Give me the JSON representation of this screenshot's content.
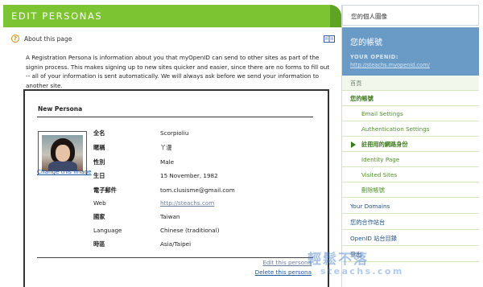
{
  "header": {
    "title": "EDIT PERSONAS"
  },
  "about": {
    "link": "About this page",
    "intro": "A Registration Persona is information about you that myOpenID can send to other sites as part of the signin process. This makes signing up to new sites quicker and easier, since there are no forms to fill out -- all of your information is sent automatically. We will always ask before we send your information to another site."
  },
  "persona": {
    "title": "New Persona",
    "change_image": "Change this image",
    "fields": [
      {
        "label": "全名",
        "value": "Scorpioliu"
      },
      {
        "label": "暱稱",
        "value": "丫漫"
      },
      {
        "label": "性別",
        "value": "Male"
      },
      {
        "label": "生日",
        "value": "15 November, 1982"
      },
      {
        "label": "電子郵件",
        "value": "tom.clusisme@gmail.com"
      },
      {
        "label": "Web",
        "value": "http://steachs.com"
      },
      {
        "label": "國家",
        "value": "Taiwan"
      },
      {
        "label": "Language",
        "value": "Chinese (traditional)"
      },
      {
        "label": "時區",
        "value": "Asia/Taipei"
      }
    ],
    "edit": "Edit this persona",
    "delete": "Delete this persona"
  },
  "sidebar": {
    "avatar_label": "您的個人圖像",
    "account_title": "您的帳號",
    "openid_label": "YOUR OPENID:",
    "openid_url": "http://steachs.myopenid.com/",
    "items": [
      {
        "label": "首頁"
      },
      {
        "label": "您的帳號"
      },
      {
        "label": "Email Settings"
      },
      {
        "label": "Authentication Settings"
      },
      {
        "label": "註冊用的網路身份"
      },
      {
        "label": "Identity Page"
      },
      {
        "label": "Visited Sites"
      },
      {
        "label": "刪除帳號"
      },
      {
        "label": "Your Domains"
      },
      {
        "label": "您的合作站台"
      },
      {
        "label": "OpenID 站台目錄"
      },
      {
        "label": "登出"
      }
    ]
  },
  "watermark": {
    "line1": "輕鬆不落",
    "line2": "steachs.com"
  },
  "colors": {
    "header_green": "#7cc432",
    "sidebar_blue": "#6a9bc6",
    "nav_green": "#4f8f2a",
    "link_blue": "#1a55a8"
  }
}
